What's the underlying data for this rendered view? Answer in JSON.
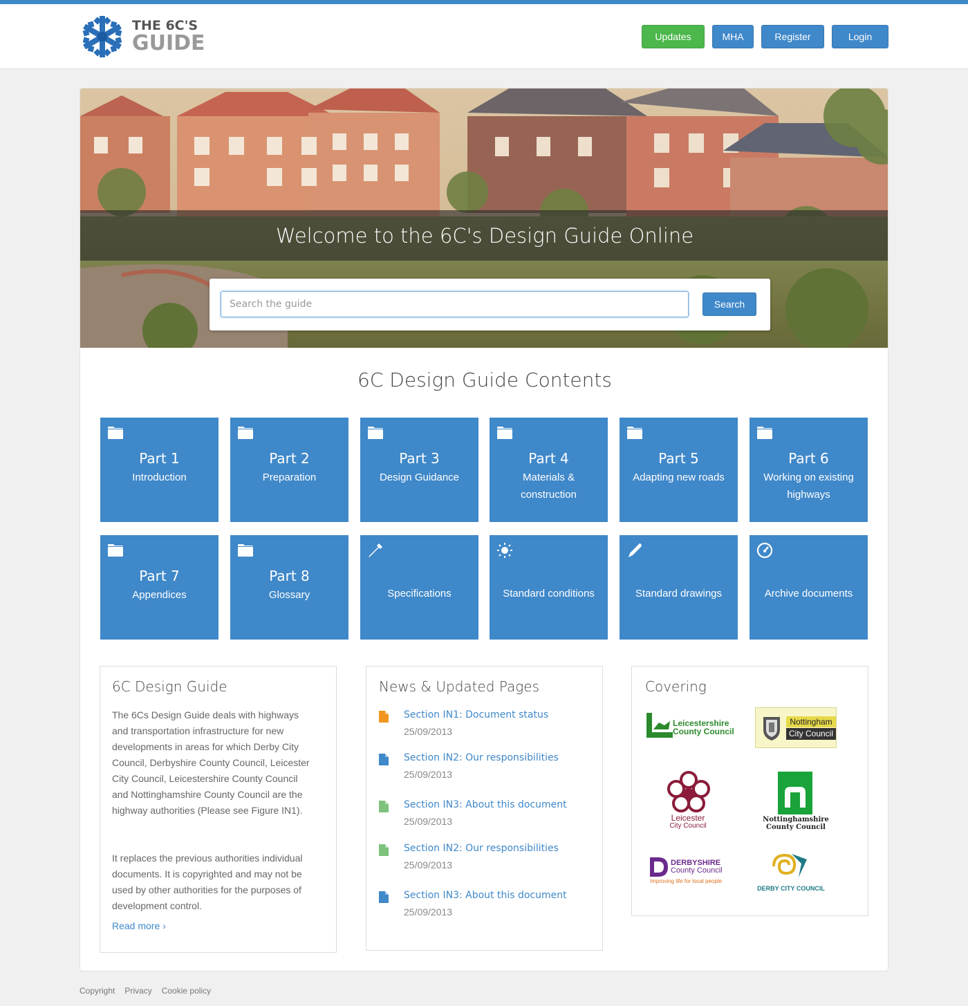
{
  "header": {
    "logo_line1": "THE 6C'S",
    "logo_line2": "GUIDE",
    "nav": [
      "Updates",
      "MHA",
      "Register",
      "Login"
    ]
  },
  "hero": {
    "title": "Welcome to the 6C's Design Guide Online",
    "search_placeholder": "Search the guide",
    "search_button": "Search"
  },
  "contents": {
    "title": "6C Design Guide Contents",
    "tiles": [
      {
        "icon": "folder-icon",
        "title": "Part 1",
        "subtitle": "Introduction"
      },
      {
        "icon": "folder-icon",
        "title": "Part 2",
        "subtitle": "Preparation"
      },
      {
        "icon": "folder-icon",
        "title": "Part 3",
        "subtitle": "Design Guidance"
      },
      {
        "icon": "folder-icon",
        "title": "Part 4",
        "subtitle": "Materials & construction"
      },
      {
        "icon": "folder-icon",
        "title": "Part 5",
        "subtitle": "Adapting new roads"
      },
      {
        "icon": "folder-icon",
        "title": "Part 6",
        "subtitle": "Working on existing highways"
      },
      {
        "icon": "folder-icon",
        "title": "Part 7",
        "subtitle": "Appendices"
      },
      {
        "icon": "folder-icon",
        "title": "Part 8",
        "subtitle": "Glossary"
      },
      {
        "icon": "eyedropper-icon",
        "title": "",
        "subtitle": "Specifications"
      },
      {
        "icon": "sun-icon",
        "title": "",
        "subtitle": "Standard conditions"
      },
      {
        "icon": "pencil-icon",
        "title": "",
        "subtitle": "Standard drawings"
      },
      {
        "icon": "dashboard-icon",
        "title": "",
        "subtitle": "Archive documents"
      }
    ]
  },
  "about": {
    "title": "6C Design Guide",
    "p1": "The 6Cs Design Guide deals with highways and transportation infrastructure for new developments in areas for which Derby City Council, Derbyshire County Council, Leicester City Council, Leicestershire County Council and Nottinghamshire County Council are the highway authorities (Please see Figure IN1).",
    "p2": "It replaces the previous authorities individual documents.  It is copyrighted and may not be used by other authorities for the purposes of development control.",
    "read_more": "Read more ›"
  },
  "news": {
    "title": "News & Updated Pages",
    "items": [
      {
        "label": "Section IN1: Document status",
        "date": "25/09/2013",
        "color": "#f0961e"
      },
      {
        "label": "Section IN2: Our responsibilities",
        "date": "25/09/2013",
        "color": "#3f88c9"
      },
      {
        "label": "Section IN3: About this document",
        "date": "25/09/2013",
        "color": "#7dc27d"
      },
      {
        "label": "Section IN2: Our responsibilities",
        "date": "25/09/2013",
        "color": "#7dc27d"
      },
      {
        "label": "Section IN3: About this document",
        "date": "25/09/2013",
        "color": "#3f88c9"
      }
    ]
  },
  "covering": {
    "title": "Covering",
    "councils": {
      "leicestershire": [
        "Leicestershire",
        "County Council"
      ],
      "nottingham": [
        "Nottingham",
        "City Council"
      ],
      "leicester": [
        "Leicester",
        "City Council"
      ],
      "nottinghamshire": [
        "Nottinghamshire",
        "County Council"
      ],
      "derbyshire": [
        "DERBYSHIRE",
        "County Council",
        "Improving life for local people"
      ],
      "derby": [
        "DERBY CITY COUNCIL"
      ]
    }
  },
  "footer": [
    "Copyright",
    "Privacy",
    "Cookie policy"
  ],
  "colors": {
    "primary": "#3f88c9",
    "success": "#4cb74c"
  }
}
